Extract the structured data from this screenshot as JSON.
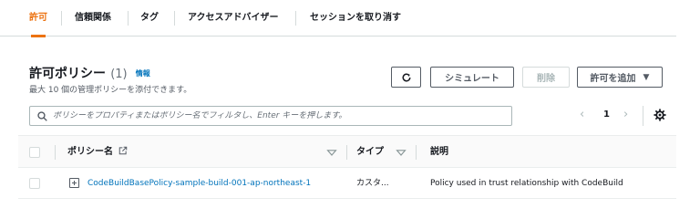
{
  "tabs": [
    {
      "label": "許可",
      "active": true
    },
    {
      "label": "信頼関係",
      "active": false
    },
    {
      "label": "タグ",
      "active": false
    },
    {
      "label": "アクセスアドバイザー",
      "active": false
    },
    {
      "label": "セッションを取り消す",
      "active": false
    }
  ],
  "panel": {
    "title": "許可ポリシー",
    "count": "(1)",
    "info_link": "情報",
    "description": "最大 10 個の管理ポリシーを添付できます。"
  },
  "toolbar": {
    "refresh_icon": "refresh-icon",
    "simulate_label": "シミュレート",
    "delete_label": "削除",
    "add_permissions_label": "許可を追加"
  },
  "search": {
    "placeholder": "ポリシーをプロパティまたはポリシー名でフィルタし、Enter キーを押します。"
  },
  "pagination": {
    "current_page": "1"
  },
  "table": {
    "columns": [
      "ポリシー名",
      "タイプ",
      "説明"
    ],
    "rows": [
      {
        "policy_name": "CodeBuildBasePolicy-sample-build-001-ap-northeast-1",
        "type": "カスタ...",
        "description": "Policy used in trust relationship with CodeBuild"
      }
    ]
  },
  "colors": {
    "accent": "#ec7211",
    "link": "#0073bb",
    "text": "#16191f",
    "border": "#d5dbdb"
  }
}
